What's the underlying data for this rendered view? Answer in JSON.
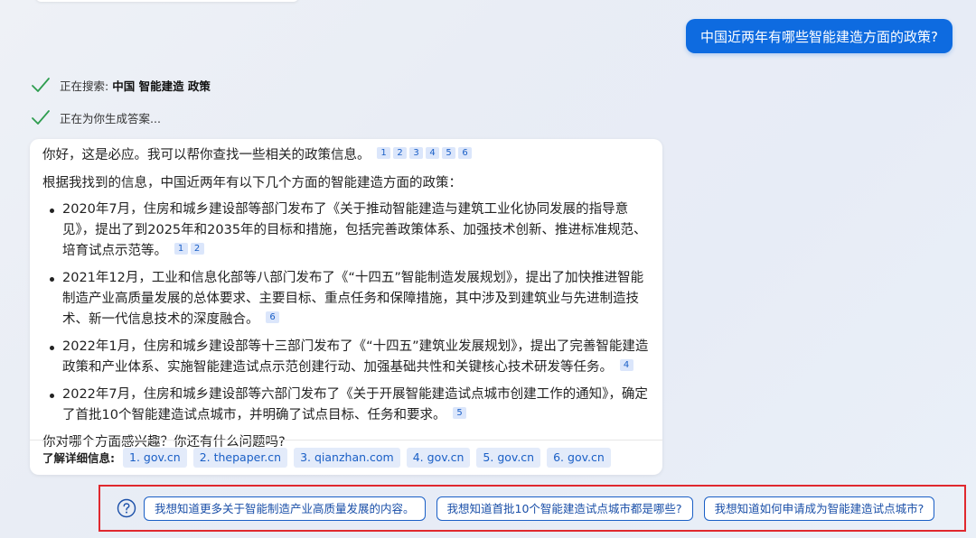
{
  "user_message": "中国近两年有哪些智能建造方面的政策?",
  "status": {
    "searching_label": "正在搜索:",
    "searching_query": "中国 智能建造 政策",
    "generating_label": "正在为你生成答案..."
  },
  "answer": {
    "intro": "你好，这是必应。我可以帮你查找一些相关的政策信息。",
    "intro_citations": [
      "1",
      "2",
      "3",
      "4",
      "5",
      "6"
    ],
    "lead": "根据我找到的信息，中国近两年有以下几个方面的智能建造方面的政策：",
    "bullets": [
      {
        "text": "2020年7月，住房和城乡建设部等部门发布了《关于推动智能建造与建筑工业化协同发展的指导意见》，提出了到2025年和2035年的目标和措施，包括完善政策体系、加强技术创新、推进标准规范、培育试点示范等。",
        "citations": [
          "1",
          "2"
        ]
      },
      {
        "text": "2021年12月，工业和信息化部等八部门发布了《“十四五”智能制造发展规划》，提出了加快推进智能制造产业高质量发展的总体要求、主要目标、重点任务和保障措施，其中涉及到建筑业与先进制造技术、新一代信息技术的深度融合。",
        "citations": [
          "6"
        ]
      },
      {
        "text": "2022年1月，住房和城乡建设部等十三部门发布了《“十四五”建筑业发展规划》，提出了完善智能建造政策和产业体系、实施智能建造试点示范创建行动、加强基础共性和关键核心技术研发等任务。",
        "citations": [
          "4"
        ]
      },
      {
        "text": "2022年7月，住房和城乡建设部等六部门发布了《关于开展智能建造试点城市创建工作的通知》，确定了首批10个智能建造试点城市，并明确了试点目标、任务和要求。",
        "citations": [
          "5"
        ]
      }
    ],
    "outro": "你对哪个方面感兴趣？你还有什么问题吗?"
  },
  "learn_more": {
    "label": "了解详细信息:",
    "sources": [
      "1. gov.cn",
      "2. thepaper.cn",
      "3. qianzhan.com",
      "4. gov.cn",
      "5. gov.cn",
      "6. gov.cn"
    ]
  },
  "suggestions": [
    "我想知道更多关于智能制造产业高质量发展的内容。",
    "我想知道首批10个智能建造试点城市都是哪些?",
    "我想知道如何申请成为智能建造试点城市?"
  ],
  "colors": {
    "accent": "#0e6be0",
    "check": "#2e9d4f",
    "highlight_border": "#e0282e"
  }
}
